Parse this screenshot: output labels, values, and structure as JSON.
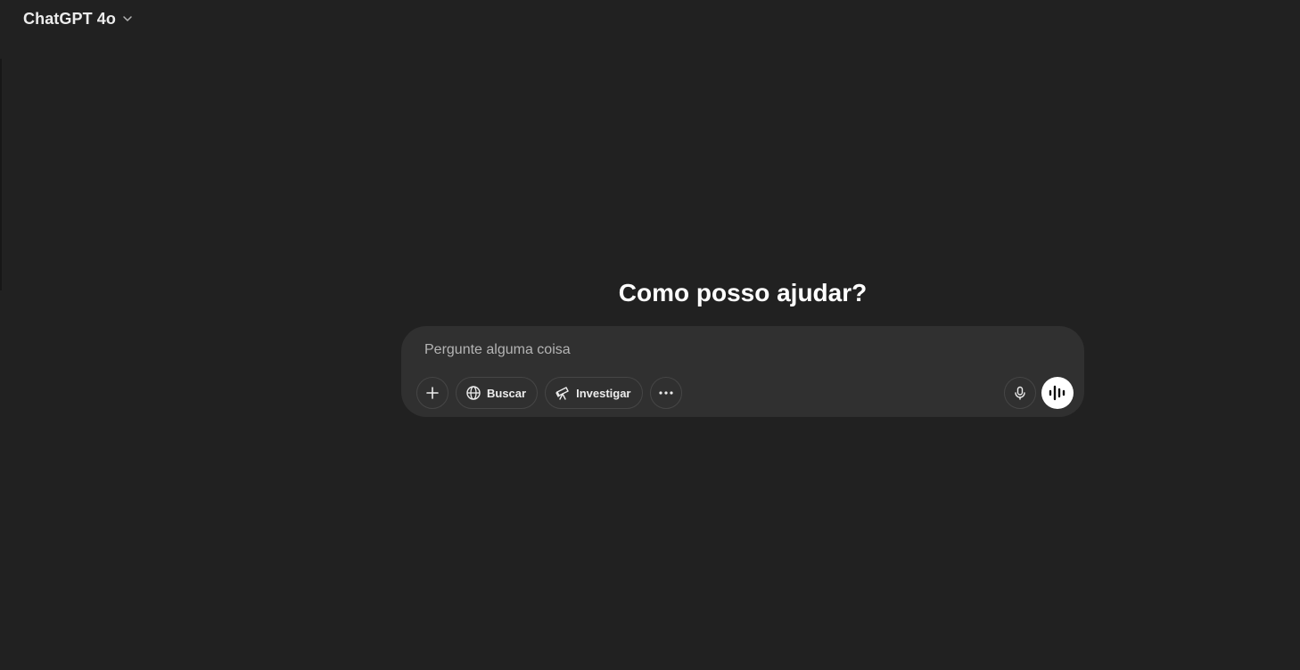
{
  "header": {
    "model_name": "ChatGPT 4o",
    "dropdown_icon": "chevron-down-icon"
  },
  "main": {
    "headline": "Como posso ajudar?"
  },
  "composer": {
    "placeholder": "Pergunte alguma coisa",
    "value": "",
    "tools": {
      "attach_icon": "plus-icon",
      "search_label": "Buscar",
      "search_icon": "globe-icon",
      "research_label": "Investigar",
      "research_icon": "telescope-icon",
      "more_icon": "more-horizontal-icon"
    },
    "actions": {
      "dictate_icon": "microphone-icon",
      "voice_mode_icon": "voice-waveform-icon"
    }
  },
  "colors": {
    "background": "#212121",
    "composer_background": "#303030",
    "text_primary": "#ececec",
    "placeholder": "#b4b4b4",
    "voice_button": "#ffffff"
  }
}
